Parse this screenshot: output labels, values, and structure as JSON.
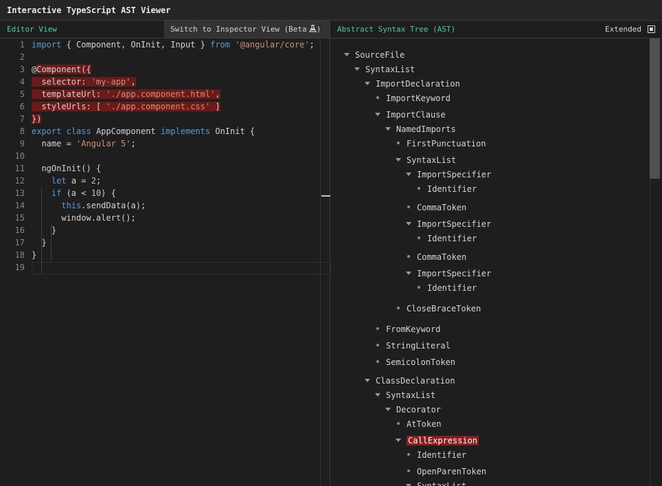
{
  "window": {
    "title": "Interactive TypeScript AST Viewer"
  },
  "editor": {
    "title": "Editor View",
    "switch_label": "Switch to Inspector View (Beta",
    "switch_suffix": ")",
    "lines": [
      {
        "n": "1",
        "tokens": [
          {
            "t": "import",
            "c": "kw"
          },
          {
            "t": " { Component, OnInit, Input } "
          },
          {
            "t": "from",
            "c": "kw"
          },
          {
            "t": " "
          },
          {
            "t": "'@angular/core'",
            "c": "str"
          },
          {
            "t": ";"
          }
        ]
      },
      {
        "n": "2",
        "tokens": []
      },
      {
        "n": "3",
        "tokens": [
          {
            "t": "@"
          },
          {
            "t": "Component({",
            "c": "hl"
          }
        ]
      },
      {
        "n": "4",
        "tokens": [
          {
            "t": "  selector: ",
            "c": "hl"
          },
          {
            "t": "'my-app'",
            "c": "hl str"
          },
          {
            "t": ",",
            "c": "hl"
          }
        ]
      },
      {
        "n": "5",
        "tokens": [
          {
            "t": "  templateUrl: ",
            "c": "hl"
          },
          {
            "t": "'./app.component.html'",
            "c": "hl str"
          },
          {
            "t": ",",
            "c": "hl"
          }
        ]
      },
      {
        "n": "6",
        "tokens": [
          {
            "t": "  styleUrls: [ ",
            "c": "hl"
          },
          {
            "t": "'./app.component.css'",
            "c": "hl str"
          },
          {
            "t": " ]",
            "c": "hl"
          }
        ]
      },
      {
        "n": "7",
        "tokens": [
          {
            "t": "})",
            "c": "hl"
          }
        ]
      },
      {
        "n": "8",
        "tokens": [
          {
            "t": "export",
            "c": "kw"
          },
          {
            "t": " "
          },
          {
            "t": "class",
            "c": "kw"
          },
          {
            "t": " AppComponent "
          },
          {
            "t": "implements",
            "c": "kw"
          },
          {
            "t": " OnInit {"
          }
        ]
      },
      {
        "n": "9",
        "tokens": [
          {
            "t": "  name = "
          },
          {
            "t": "'Angular 5'",
            "c": "str"
          },
          {
            "t": ";"
          }
        ]
      },
      {
        "n": "10",
        "tokens": []
      },
      {
        "n": "11",
        "tokens": [
          {
            "t": "  ngOnInit() {"
          }
        ]
      },
      {
        "n": "12",
        "tokens": [
          {
            "t": "    "
          },
          {
            "t": "let",
            "c": "kw"
          },
          {
            "t": " a = "
          },
          {
            "t": "2",
            "c": "num"
          },
          {
            "t": ";"
          }
        ]
      },
      {
        "n": "13",
        "tokens": [
          {
            "t": "    "
          },
          {
            "t": "if",
            "c": "kw"
          },
          {
            "t": " (a < "
          },
          {
            "t": "10",
            "c": "num"
          },
          {
            "t": ") {"
          }
        ]
      },
      {
        "n": "14",
        "tokens": [
          {
            "t": "      "
          },
          {
            "t": "this",
            "c": "kw"
          },
          {
            "t": ".sendData(a);"
          }
        ]
      },
      {
        "n": "15",
        "tokens": [
          {
            "t": "      window.alert();"
          }
        ]
      },
      {
        "n": "16",
        "tokens": [
          {
            "t": "    }"
          }
        ]
      },
      {
        "n": "17",
        "tokens": [
          {
            "t": "  }"
          }
        ]
      },
      {
        "n": "18",
        "tokens": [
          {
            "t": "}"
          }
        ]
      },
      {
        "n": "19",
        "tokens": []
      }
    ]
  },
  "ast": {
    "title": "Abstract Syntax Tree (AST)",
    "extended_label": "Extended",
    "extended_checked": true,
    "nodes": [
      {
        "label": "SourceFile",
        "depth": 0,
        "kind": "expanded"
      },
      {
        "label": "SyntaxList",
        "depth": 1,
        "kind": "expanded"
      },
      {
        "label": "ImportDeclaration",
        "depth": 2,
        "kind": "expanded"
      },
      {
        "label": "ImportKeyword",
        "depth": 3,
        "kind": "leaf"
      },
      {
        "label": "ImportClause",
        "depth": 3,
        "kind": "expanded"
      },
      {
        "label": "NamedImports",
        "depth": 4,
        "kind": "expanded"
      },
      {
        "label": "FirstPunctuation",
        "depth": 5,
        "kind": "leaf"
      },
      {
        "label": "SyntaxList",
        "depth": 5,
        "kind": "expanded"
      },
      {
        "label": "ImportSpecifier",
        "depth": 6,
        "kind": "expanded"
      },
      {
        "label": "Identifier",
        "depth": 7,
        "kind": "leaf"
      },
      {
        "label": "CommaToken",
        "depth": 6,
        "kind": "leaf"
      },
      {
        "label": "ImportSpecifier",
        "depth": 6,
        "kind": "expanded"
      },
      {
        "label": "Identifier",
        "depth": 7,
        "kind": "leaf"
      },
      {
        "label": "CommaToken",
        "depth": 6,
        "kind": "leaf"
      },
      {
        "label": "ImportSpecifier",
        "depth": 6,
        "kind": "expanded"
      },
      {
        "label": "Identifier",
        "depth": 7,
        "kind": "leaf"
      },
      {
        "label": "CloseBraceToken",
        "depth": 5,
        "kind": "leaf"
      },
      {
        "label": "FromKeyword",
        "depth": 3,
        "kind": "leaf"
      },
      {
        "label": "StringLiteral",
        "depth": 3,
        "kind": "leaf"
      },
      {
        "label": "SemicolonToken",
        "depth": 3,
        "kind": "leaf"
      },
      {
        "label": "ClassDeclaration",
        "depth": 2,
        "kind": "expanded"
      },
      {
        "label": "SyntaxList",
        "depth": 3,
        "kind": "expanded"
      },
      {
        "label": "Decorator",
        "depth": 4,
        "kind": "expanded"
      },
      {
        "label": "AtToken",
        "depth": 5,
        "kind": "leaf"
      },
      {
        "label": "CallExpression",
        "depth": 5,
        "kind": "expanded",
        "selected": true
      },
      {
        "label": "Identifier",
        "depth": 6,
        "kind": "leaf"
      },
      {
        "label": "OpenParenToken",
        "depth": 6,
        "kind": "leaf"
      },
      {
        "label": "SyntaxList",
        "depth": 6,
        "kind": "expanded"
      }
    ]
  },
  "colors": {
    "accent": "#4ec9b0",
    "highlight": "#6b1a1a",
    "selected": "#8b1e1e"
  }
}
